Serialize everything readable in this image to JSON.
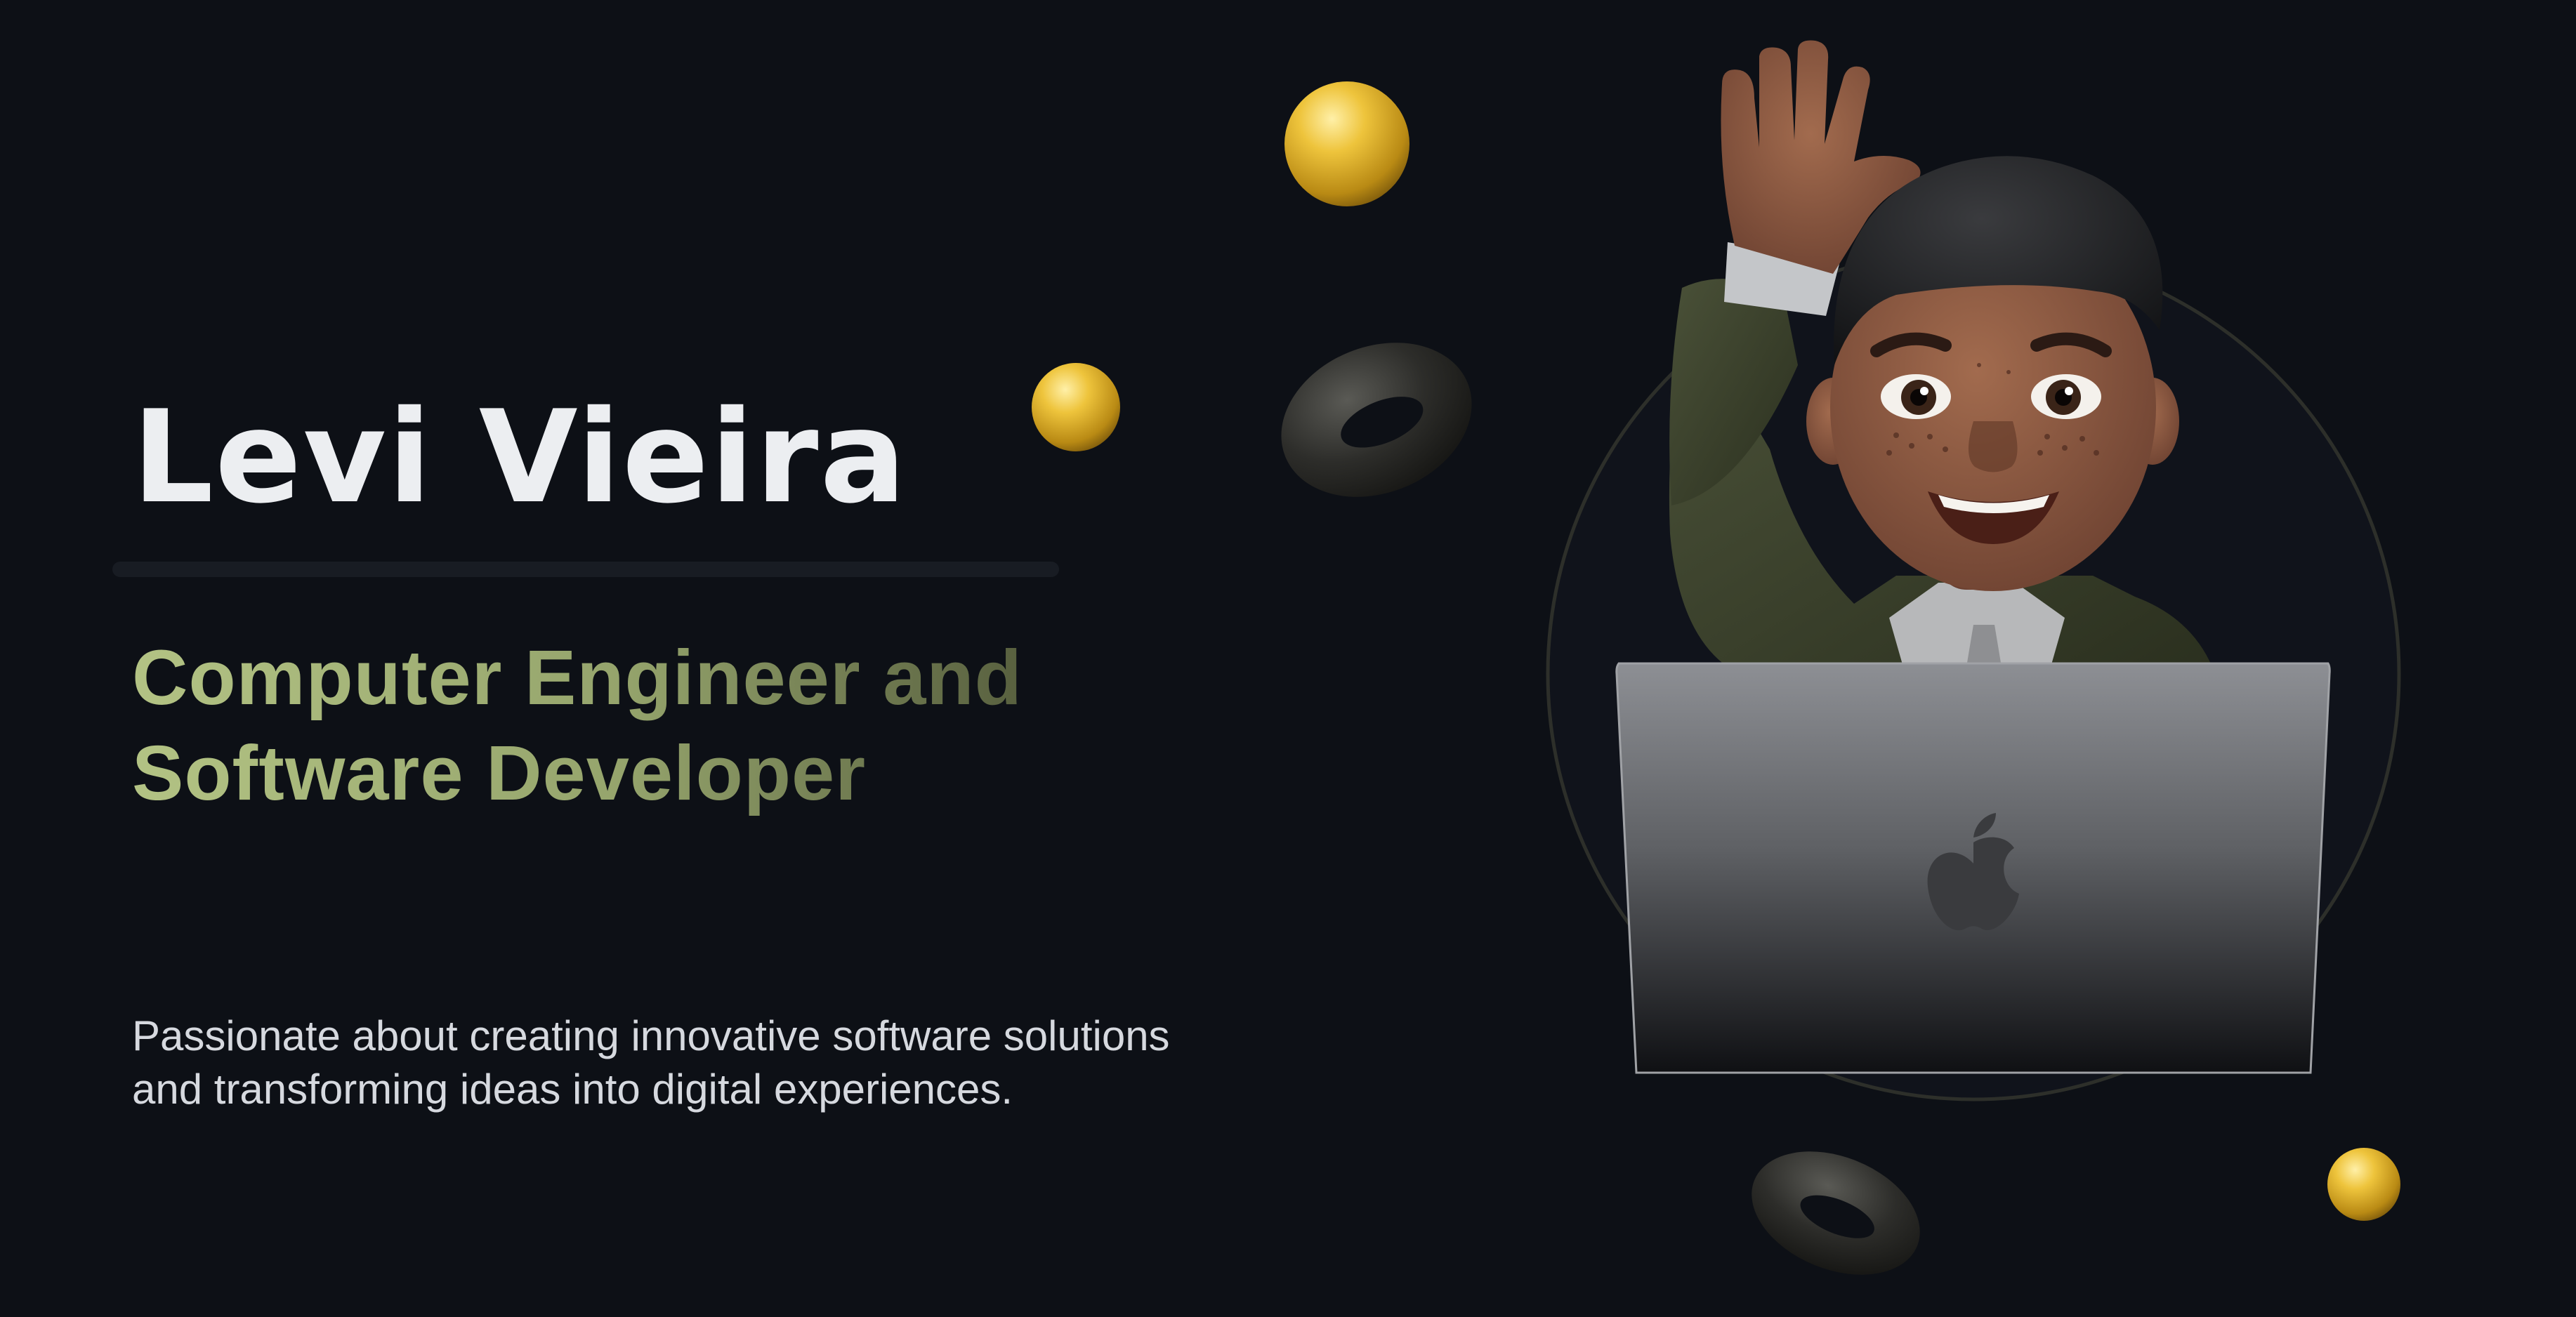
{
  "hero": {
    "name": "Levi Vieira",
    "role_line1": "Computer Engineer and",
    "role_line2": "Software Developer",
    "tagline_line1": "Passionate about creating innovative software solutions",
    "tagline_line2": "and transforming ideas into digital experiences."
  },
  "colors": {
    "background": "#0d1016",
    "name": "#eceef1",
    "role_gradient_start": "#b3c384",
    "role_gradient_end": "#58603f",
    "tagline": "#d6d9df",
    "sphere": "#e2b52f",
    "torus": "#2b2b28"
  },
  "decor": {
    "avatar": "memoji-waving-with-laptop",
    "laptop_logo": "apple-logo-icon",
    "objects": [
      "gold-sphere",
      "gold-sphere",
      "gold-sphere",
      "dark-torus",
      "dark-torus"
    ]
  }
}
